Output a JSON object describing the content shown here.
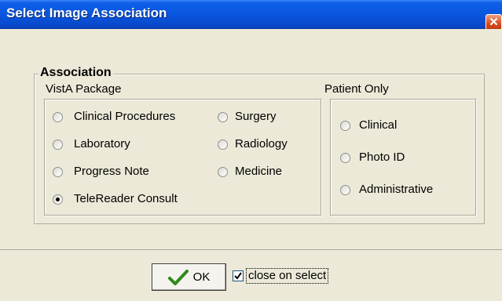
{
  "window": {
    "title": "Select Image Association",
    "close_glyph": "✕"
  },
  "association": {
    "title": "Association",
    "vista": {
      "label": "VistA Package",
      "options": [
        {
          "label": "Clinical Procedures",
          "checked": false
        },
        {
          "label": "Laboratory",
          "checked": false
        },
        {
          "label": "Progress Note",
          "checked": false
        },
        {
          "label": "TeleReader Consult",
          "checked": true
        },
        {
          "label": "Surgery",
          "checked": false
        },
        {
          "label": "Radiology",
          "checked": false
        },
        {
          "label": "Medicine",
          "checked": false
        }
      ]
    },
    "patient": {
      "label": "Patient Only",
      "options": [
        {
          "label": "Clinical",
          "checked": false
        },
        {
          "label": "Photo ID",
          "checked": false
        },
        {
          "label": "Administrative",
          "checked": false
        }
      ]
    }
  },
  "footer": {
    "ok_label": "OK",
    "ok_icon": "checkmark-icon",
    "close_on_select_label": "close on select",
    "close_on_select_checked": true
  },
  "colors": {
    "titlebar": "#0a55df",
    "dialog_bg": "#ece9d8",
    "ok_check": "#2f8a1a"
  }
}
